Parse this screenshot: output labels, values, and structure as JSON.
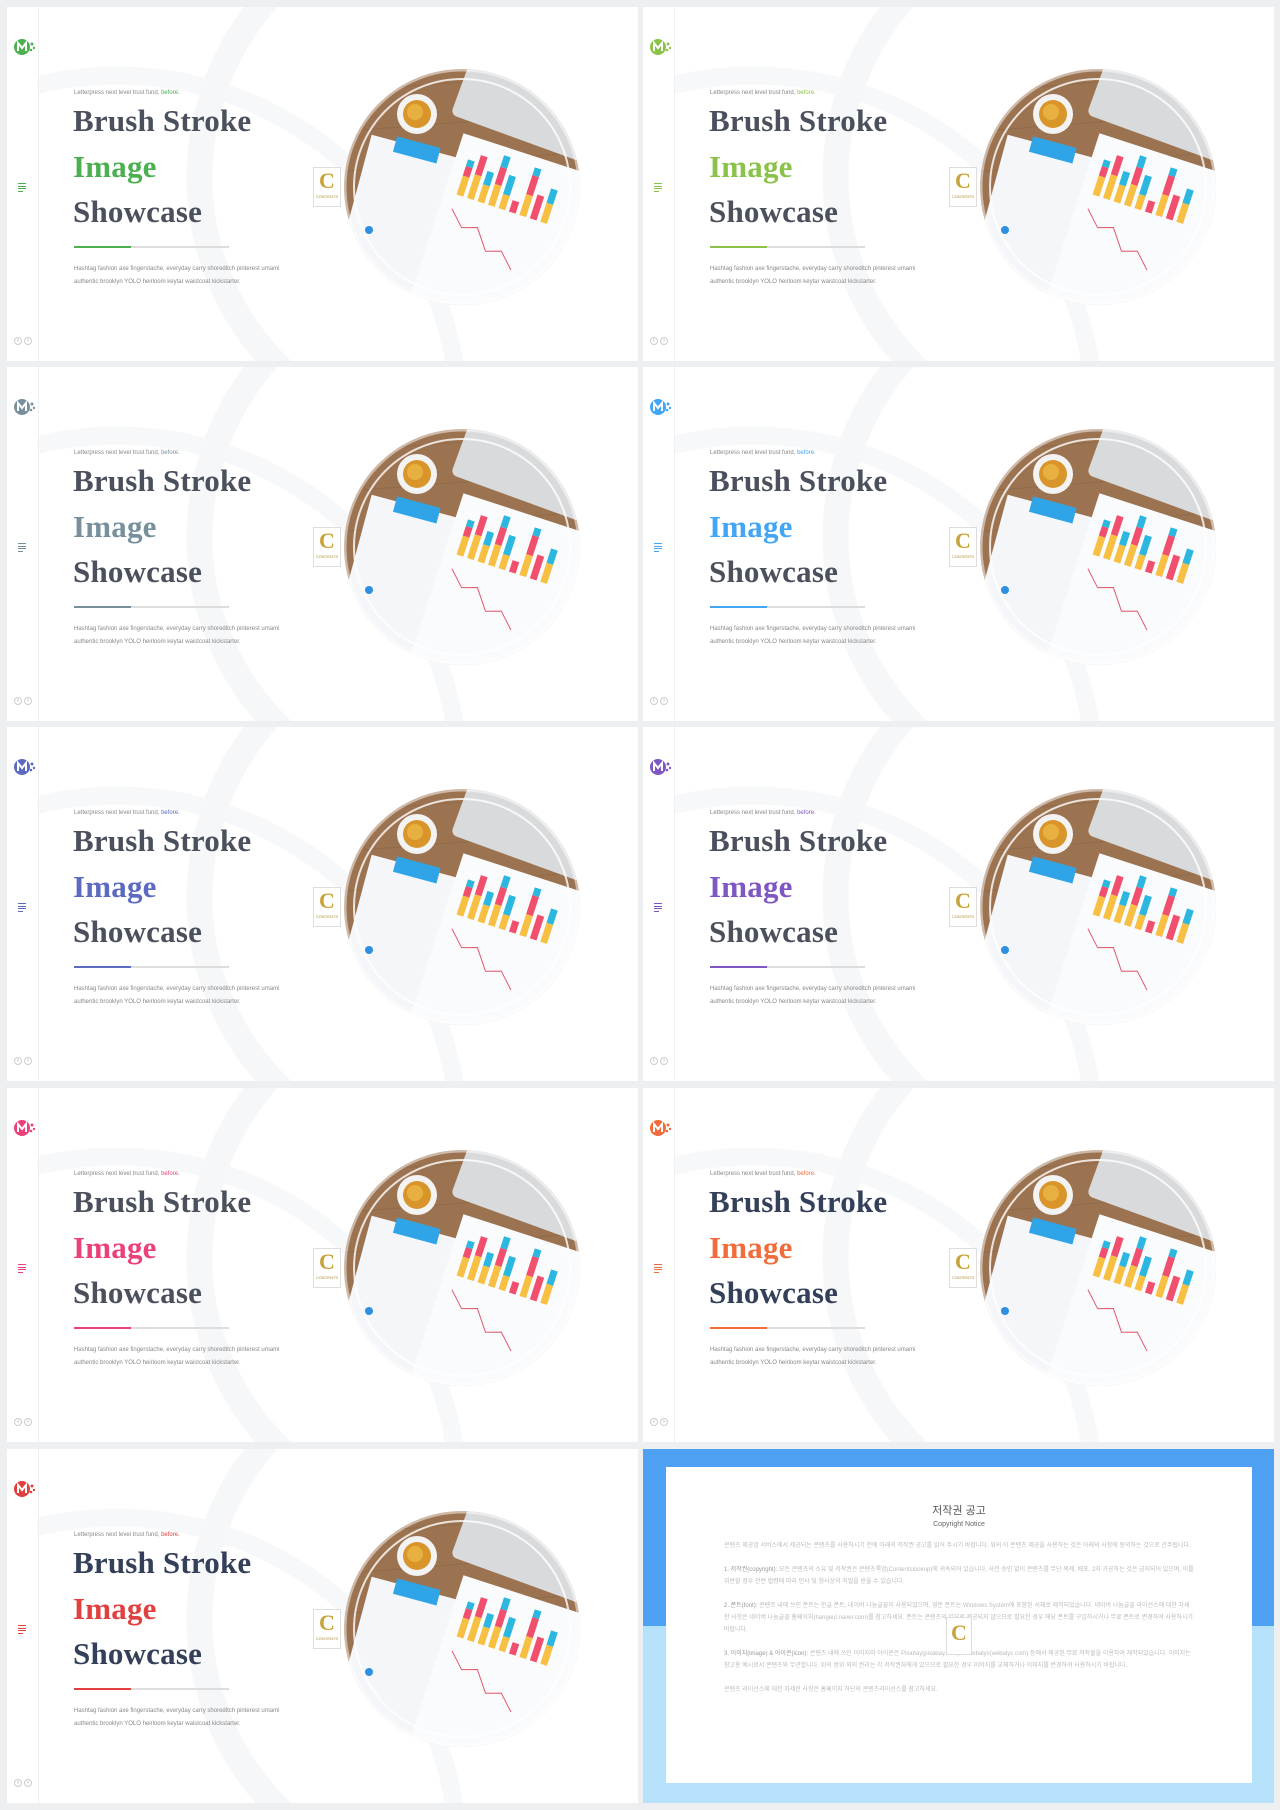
{
  "slides": [
    {
      "kicker": "Letterpress next level trust fund,",
      "kicker_accent": "before.",
      "line1": "Brush Stroke",
      "line2": "Image",
      "line3": "Showcase",
      "body": "Hashtag fashion axe fingerstache, everyday carry shoreditch pinterest umami authentic brooklyn YOLO heirloom keytar waistcoat kickstarter.",
      "accent": "#4caf50",
      "title_color": "#4a505c",
      "badge": "C",
      "badge_text": "CONTENTS"
    },
    {
      "kicker": "Letterpress next level trust fund,",
      "kicker_accent": "before.",
      "line1": "Brush Stroke",
      "line2": "Image",
      "line3": "Showcase",
      "body": "Hashtag fashion axe fingerstache, everyday carry shoreditch pinterest umami authentic brooklyn YOLO heirloom keytar waistcoat kickstarter.",
      "accent": "#8bc34a",
      "title_color": "#4a505c",
      "badge": "C",
      "badge_text": "CONTENTS"
    },
    {
      "kicker": "Letterpress next level trust fund,",
      "kicker_accent": "before.",
      "line1": "Brush Stroke",
      "line2": "Image",
      "line3": "Showcase",
      "body": "Hashtag fashion axe fingerstache, everyday carry shoreditch pinterest umami authentic brooklyn YOLO heirloom keytar waistcoat kickstarter.",
      "accent": "#78909c",
      "title_color": "#4a505c",
      "badge": "C",
      "badge_text": "CONTENTS"
    },
    {
      "kicker": "Letterpress next level trust fund,",
      "kicker_accent": "before.",
      "line1": "Brush Stroke",
      "line2": "Image",
      "line3": "Showcase",
      "body": "Hashtag fashion axe fingerstache, everyday carry shoreditch pinterest umami authentic brooklyn YOLO heirloom keytar waistcoat kickstarter.",
      "accent": "#42a5f5",
      "title_color": "#4a505c",
      "badge": "C",
      "badge_text": "CONTENTS"
    },
    {
      "kicker": "Letterpress next level trust fund,",
      "kicker_accent": "before.",
      "line1": "Brush Stroke",
      "line2": "Image",
      "line3": "Showcase",
      "body": "Hashtag fashion axe fingerstache, everyday carry shoreditch pinterest umami authentic brooklyn YOLO heirloom keytar waistcoat kickstarter.",
      "accent": "#5c6bc0",
      "title_color": "#4a505c",
      "badge": "C",
      "badge_text": "CONTENTS"
    },
    {
      "kicker": "Letterpress next level trust fund,",
      "kicker_accent": "before.",
      "line1": "Brush Stroke",
      "line2": "Image",
      "line3": "Showcase",
      "body": "Hashtag fashion axe fingerstache, everyday carry shoreditch pinterest umami authentic brooklyn YOLO heirloom keytar waistcoat kickstarter.",
      "accent": "#7e57c2",
      "title_color": "#4a505c",
      "badge": "C",
      "badge_text": "CONTENTS"
    },
    {
      "kicker": "Letterpress next level trust fund,",
      "kicker_accent": "before.",
      "line1": "Brush Stroke",
      "line2": "Image",
      "line3": "Showcase",
      "body": "Hashtag fashion axe fingerstache, everyday carry shoreditch pinterest umami authentic brooklyn YOLO heirloom keytar waistcoat kickstarter.",
      "accent": "#ec407a",
      "title_color": "#4a505c",
      "badge": "C",
      "badge_text": "CONTENTS"
    },
    {
      "kicker": "Letterpress next level trust fund,",
      "kicker_accent": "before.",
      "line1": "Brush Stroke",
      "line2": "Image",
      "line3": "Showcase",
      "body": "Hashtag fashion axe fingerstache, everyday carry shoreditch pinterest umami authentic brooklyn YOLO heirloom keytar waistcoat kickstarter.",
      "accent": "#f26b3a",
      "title_color": "#34405a",
      "badge": "C",
      "badge_text": "CONTENTS"
    },
    {
      "kicker": "Letterpress next level trust fund,",
      "kicker_accent": "before.",
      "line1": "Brush Stroke",
      "line2": "Image",
      "line3": "Showcase",
      "body": "Hashtag fashion axe fingerstache, everyday carry shoreditch pinterest umami authentic brooklyn YOLO heirloom keytar waistcoat kickstarter.",
      "accent": "#e0403f",
      "title_color": "#34405a",
      "badge": "C",
      "badge_text": "CONTENTS"
    }
  ],
  "copyright": {
    "title": "저작권 공고",
    "subtitle": "Copyright Notice",
    "intro": "콘텐츠 제공업 서비스에서 제공되는 콘텐츠를 사용하시기 전에 아래의 저작권 공고를 읽어 주시기 바랍니다. 위의 이 콘텐츠 제공을 사용하는 것은 아래의 사항에 동의하는 것으로 간주됩니다.",
    "items": [
      {
        "head": "1. 저작권(copyright):",
        "text": "모든 콘텐츠의 소유 및 저작권은 콘텐츠룩업(Contentslookup)에 귀속되어 있습니다. 사전 승인 없이 콘텐츠를 무단 복제, 배포, 2차 가공하는 것은 금지되어 있으며, 이를 위반할 경우 관련 법령에 따라 민사 및 형사상의 처벌을 받을 수 있습니다."
      },
      {
        "head": "2. 폰트(font):",
        "text": "콘텐츠 내에 쓰인 폰트는 한글 폰트, 네이버 나눔글꼴이 사용되었으며, 영문 폰트는 Windows System에 포함된 서체로 제작되었습니다. 네이버 나눔글꼴 라이선스에 대한 자세한 사항은 네이버 나눔글꼴 홈페이지(hangeul.naver.com)를 참고하세요. 폰트는 콘텐츠의 일부로 제공되지 않으므로 필요한 경우 해당 폰트를 구입하시거나 무료 폰트로 변경하여 사용하시기 바랍니다."
      },
      {
        "head": "3. 이미지(image) & 아이콘(icon):",
        "text": "콘텐츠 내에 쓰인 이미지와 아이콘은 Pixabay(pixabay.com)와 Webalys(webalys.com) 등에서 제공된 무료 저작물을 이용하여 제작되었습니다. 이미지는 참고용 예시로서 콘텐츠와 무관합니다. 위의 범위 외의 권리는 각 저작권자에게 있으므로 필요한 경우 이미지를 교체하거나 이미지를 변경하여 사용하시기 바랍니다."
      }
    ],
    "footer": "콘텐츠 라이선스에 대한 자세한 사항은 홈페이지 하단의 콘텐츠라이선스를 참고하세요.",
    "badge": "C",
    "band_color": "#4ea1f2",
    "band_light_color": "#b6e1fb"
  }
}
